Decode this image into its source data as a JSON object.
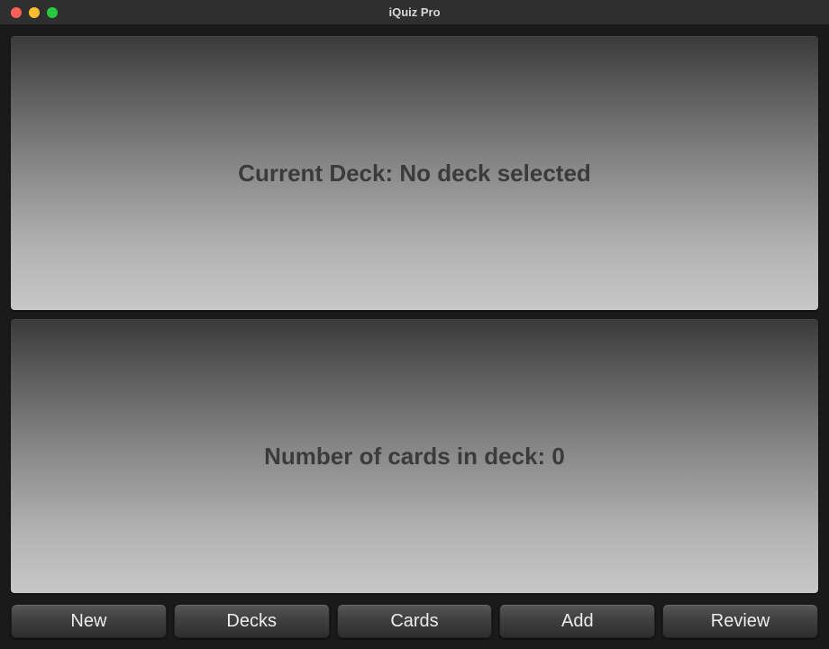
{
  "window": {
    "title": "iQuiz Pro"
  },
  "panels": {
    "current_deck_label": "Current Deck: No deck selected",
    "card_count_label": "Number of cards in deck: 0"
  },
  "toolbar": {
    "new_label": "New",
    "decks_label": "Decks",
    "cards_label": "Cards",
    "add_label": "Add",
    "review_label": "Review"
  }
}
